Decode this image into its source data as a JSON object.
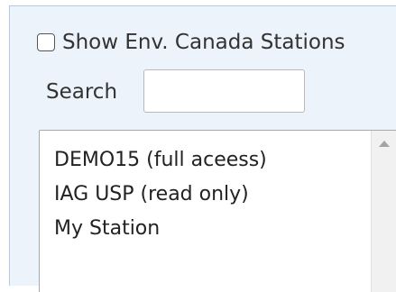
{
  "env_canada": {
    "label": "Show Env. Canada Stations",
    "checked": false
  },
  "search": {
    "label": "Search",
    "value": "",
    "placeholder": ""
  },
  "stations": {
    "items": [
      "DEMO15 (full aceess)",
      "IAG USP (read only)",
      "My Station"
    ]
  },
  "colors": {
    "panel_background": "#ecf3fb",
    "panel_border": "#b9c8d8",
    "text": "#333333"
  },
  "icons": {
    "scroll_up": "triangle-up"
  }
}
